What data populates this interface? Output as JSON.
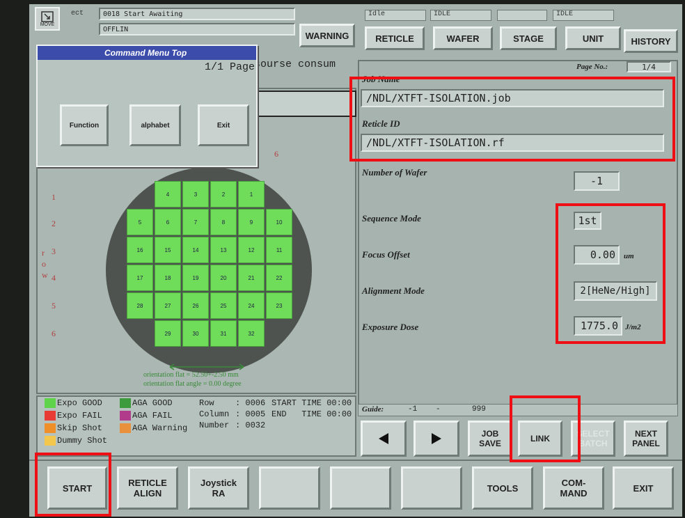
{
  "header": {
    "move_label": "MOVE",
    "status_line1": "0018  Start Awaiting",
    "status_line2": "OFFLIN",
    "warning_label": "WARNING",
    "status_prefix": "ect"
  },
  "top_status": [
    "Idle",
    "IDLE",
    "",
    "IDLE"
  ],
  "top_tabs": [
    "RETICLE",
    "WAFER",
    "STAGE",
    "UNIT",
    "HISTORY"
  ],
  "command_menu": {
    "title": "Command Menu Top",
    "page_text": "1/1 Page",
    "buttons": [
      "Function",
      "alphabet",
      "Exit"
    ]
  },
  "bg_message": "ht sourse consum",
  "page_no_label": "Page No.:",
  "page_no_value": "1/4",
  "right_panel": {
    "job_name_label": "Job Name",
    "job_name_value": "/NDL/XTFT-ISOLATION.job",
    "reticle_id_label": "Reticle ID",
    "reticle_id_value": "/NDL/XTFT-ISOLATION.rf",
    "num_wafer_label": "Number of Wafer",
    "num_wafer_value": "-1",
    "sequence_mode_label": "Sequence Mode",
    "sequence_mode_value": "1st",
    "focus_offset_label": "Focus Offset",
    "focus_offset_value": "0.00",
    "focus_offset_unit": "um",
    "alignment_mode_label": "Alignment Mode",
    "alignment_mode_value": "2[HeNe/High]",
    "exposure_dose_label": "Exposure Dose",
    "exposure_dose_value": "1775.0",
    "exposure_dose_unit": "J/m2"
  },
  "guide": {
    "label": "Guide:",
    "min": "-1",
    "dash": "-",
    "max": "999"
  },
  "nav_buttons": {
    "prev_icon": "left-triangle-icon",
    "next_icon": "right-triangle-icon",
    "job_save": "JOB SAVE",
    "link": "LINK",
    "select_batch": "SELECT BATCH",
    "next_panel": "NEXT PANEL"
  },
  "wafer_map": {
    "row_labels": [
      "1",
      "2",
      "3",
      "4",
      "5",
      "6"
    ],
    "axis_letters": [
      "r",
      "o",
      "w"
    ],
    "col_six_label": "6",
    "cells": [
      [
        "4",
        "3",
        "2",
        "1"
      ],
      [
        "5",
        "6",
        "7",
        "8",
        "9",
        "10"
      ],
      [
        "16",
        "15",
        "14",
        "13",
        "12",
        "11"
      ],
      [
        "17",
        "18",
        "19",
        "20",
        "21",
        "22"
      ],
      [
        "28",
        "27",
        "26",
        "25",
        "24",
        "23"
      ],
      [
        "29",
        "30",
        "31",
        "32"
      ]
    ],
    "orientation_flat": "orientation flat = 52.50+-2.50 mm",
    "orientation_angle": "orientation flat angle = 0.00 degree",
    "good_color": "#6fdc5a"
  },
  "legend": [
    {
      "label": "Expo GOOD",
      "color": "#5fd44a"
    },
    {
      "label": "Expo FAIL",
      "color": "#e83b36"
    },
    {
      "label": "Skip Shot",
      "color": "#ee8f2a"
    },
    {
      "label": "Dummy Shot",
      "color": "#f3c74c"
    },
    {
      "label": "AGA GOOD",
      "color": "#3d9a3d"
    },
    {
      "label": "AGA FAIL",
      "color": "#b23c8c"
    },
    {
      "label": "AGA Warning",
      "color": "#e8903c"
    }
  ],
  "info": {
    "row_label": "Row",
    "row_value": ": 0006",
    "column_label": "Column",
    "column_value": ": 0005",
    "number_label": "Number",
    "number_value": ": 0032",
    "start_time": "START TIME 00:00",
    "end_time": "END   TIME 00:00"
  },
  "bottom_buttons": [
    "START",
    "RETICLE ALIGN",
    "Joystick RA",
    "",
    "",
    "",
    "TOOLS",
    "COM- MAND",
    "EXIT"
  ],
  "colors": {
    "highlight": "#ee0f15",
    "panel": "#a6b3ae"
  }
}
